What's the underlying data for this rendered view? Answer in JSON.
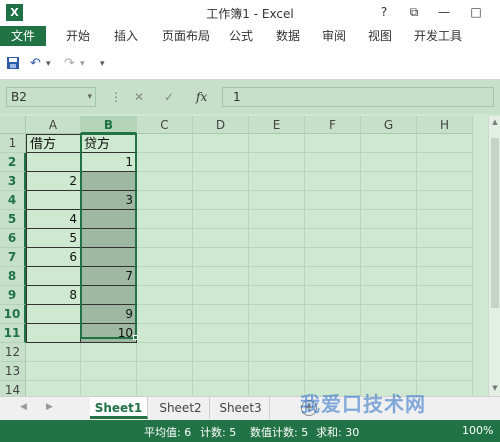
{
  "titlebar": {
    "app_icon": "X",
    "title": "工作簿1 - Excel",
    "help": "?",
    "restore": "⧉",
    "minimize": "—",
    "maximize": "□"
  },
  "ribbon_tabs": [
    "文件",
    "开始",
    "插入",
    "页面布局",
    "公式",
    "数据",
    "审阅",
    "视图",
    "开发工具"
  ],
  "qat": {
    "undo_dropdown": "▾",
    "redo_dropdown": "▾",
    "customize": "▾"
  },
  "formula_bar": {
    "name_box": "B2",
    "name_box_arrow": "▾",
    "cancel": "✕",
    "confirm": "✓",
    "fx": "fx",
    "value": "1"
  },
  "grid": {
    "columns": [
      "A",
      "B",
      "C",
      "D",
      "E",
      "F",
      "G",
      "H"
    ],
    "rows": [
      "1",
      "2",
      "3",
      "4",
      "5",
      "6",
      "7",
      "8",
      "9",
      "10",
      "11",
      "12",
      "13",
      "14"
    ],
    "cells": {
      "A1": "借方",
      "B1": "贷方",
      "B2": "1",
      "A3": "2",
      "B4": "3",
      "A5": "4",
      "A6": "5",
      "A7": "6",
      "B8": "7",
      "A9": "8",
      "B10": "9",
      "B11": "10"
    },
    "selected_column": "B"
  },
  "sheets": [
    "Sheet1",
    "Sheet2",
    "Sheet3"
  ],
  "active_sheet": "Sheet1",
  "add_sheet": "+",
  "status": {
    "average": "平均值: 6",
    "count": "计数: 5",
    "numeric_count": "数值计数: 5",
    "sum": "求和: 30",
    "zoom": "100%"
  },
  "watermark": "我爱口技术网",
  "colors": {
    "accent": "#217346",
    "sheet_bg": "#cfe8d0",
    "blank_cell": "#9eb8a2"
  }
}
